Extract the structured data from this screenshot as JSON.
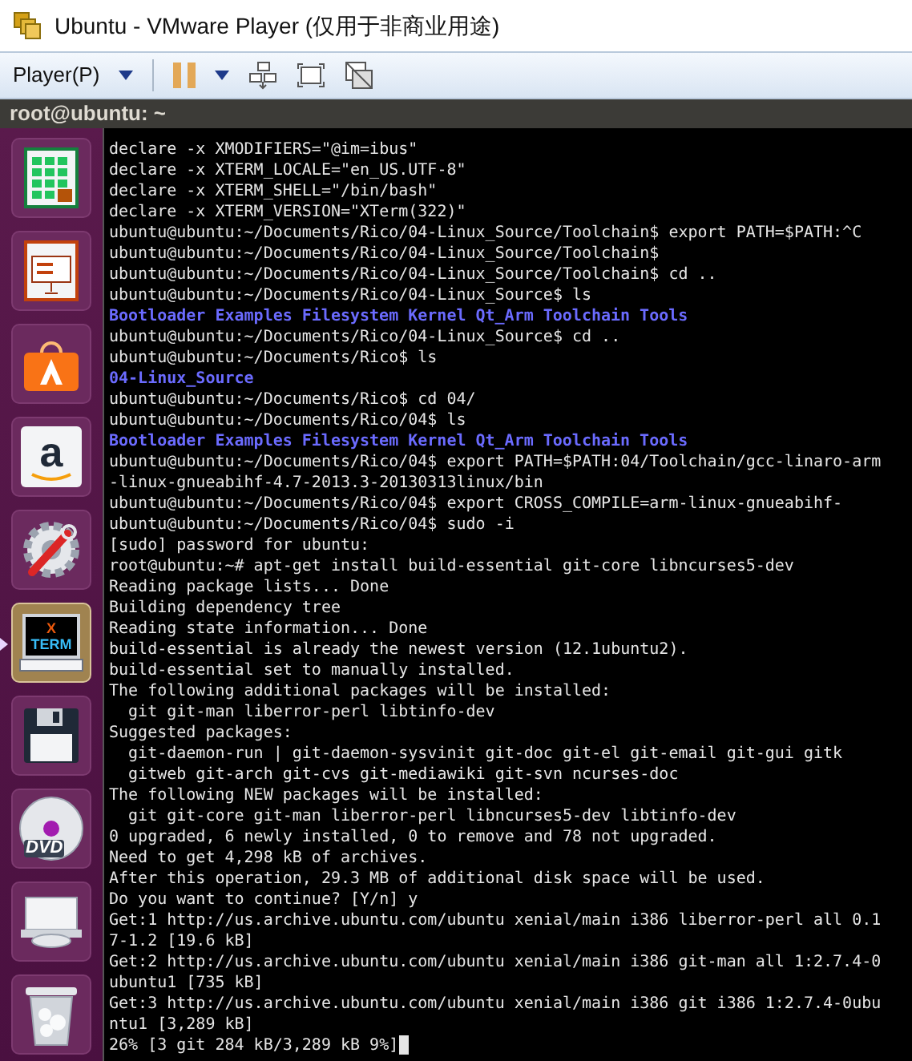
{
  "window": {
    "title": "Ubuntu - VMware Player (仅用于非商业用途)"
  },
  "toolbar": {
    "player_menu": "Player(P)"
  },
  "panel_title": "root@ubuntu: ~",
  "launcher": [
    {
      "kind": "spreadsheet",
      "selected": false
    },
    {
      "kind": "presentation",
      "selected": false
    },
    {
      "kind": "software",
      "selected": false
    },
    {
      "kind": "amazon",
      "icon_text": "a",
      "selected": false
    },
    {
      "kind": "settings",
      "selected": false
    },
    {
      "kind": "xterm",
      "icon_text": [
        "X",
        "TERM"
      ],
      "selected": true
    },
    {
      "kind": "floppy",
      "selected": false
    },
    {
      "kind": "dvd",
      "icon_text": "DVD",
      "selected": false
    },
    {
      "kind": "drive",
      "selected": false
    },
    {
      "kind": "trash",
      "selected": false
    }
  ],
  "terminal": {
    "cursor_visible": true,
    "lines": [
      {
        "kind": "text",
        "text": "declare -x XMODIFIERS=\"@im=ibus\""
      },
      {
        "kind": "text",
        "text": "declare -x XTERM_LOCALE=\"en_US.UTF-8\""
      },
      {
        "kind": "text",
        "text": "declare -x XTERM_SHELL=\"/bin/bash\""
      },
      {
        "kind": "text",
        "text": "declare -x XTERM_VERSION=\"XTerm(322)\""
      },
      {
        "kind": "text",
        "text": "ubuntu@ubuntu:~/Documents/Rico/04-Linux_Source/Toolchain$ export PATH=$PATH:^C"
      },
      {
        "kind": "text",
        "text": "ubuntu@ubuntu:~/Documents/Rico/04-Linux_Source/Toolchain$"
      },
      {
        "kind": "text",
        "text": "ubuntu@ubuntu:~/Documents/Rico/04-Linux_Source/Toolchain$ cd .."
      },
      {
        "kind": "text",
        "text": "ubuntu@ubuntu:~/Documents/Rico/04-Linux_Source$ ls"
      },
      {
        "kind": "dirs",
        "items": [
          "Bootloader",
          "Examples",
          "Filesystem",
          "Kernel",
          "Qt_Arm",
          "Toolchain",
          "Tools"
        ]
      },
      {
        "kind": "text",
        "text": "ubuntu@ubuntu:~/Documents/Rico/04-Linux_Source$ cd .."
      },
      {
        "kind": "text",
        "text": "ubuntu@ubuntu:~/Documents/Rico$ ls"
      },
      {
        "kind": "dirs",
        "items": [
          "04-Linux_Source"
        ]
      },
      {
        "kind": "text",
        "text": "ubuntu@ubuntu:~/Documents/Rico$ cd 04/"
      },
      {
        "kind": "text",
        "text": "ubuntu@ubuntu:~/Documents/Rico/04$ ls"
      },
      {
        "kind": "dirs",
        "items": [
          "Bootloader",
          "Examples",
          "Filesystem",
          "Kernel",
          "Qt_Arm",
          "Toolchain",
          "Tools"
        ]
      },
      {
        "kind": "text",
        "text": "ubuntu@ubuntu:~/Documents/Rico/04$ export PATH=$PATH:04/Toolchain/gcc-linaro-arm"
      },
      {
        "kind": "text",
        "text": "-linux-gnueabihf-4.7-2013.3-20130313linux/bin"
      },
      {
        "kind": "text",
        "text": "ubuntu@ubuntu:~/Documents/Rico/04$ export CROSS_COMPILE=arm-linux-gnueabihf-"
      },
      {
        "kind": "text",
        "text": "ubuntu@ubuntu:~/Documents/Rico/04$ sudo -i"
      },
      {
        "kind": "text",
        "text": "[sudo] password for ubuntu:"
      },
      {
        "kind": "text",
        "text": "root@ubuntu:~# apt-get install build-essential git-core libncurses5-dev"
      },
      {
        "kind": "text",
        "text": "Reading package lists... Done"
      },
      {
        "kind": "text",
        "text": "Building dependency tree"
      },
      {
        "kind": "text",
        "text": "Reading state information... Done"
      },
      {
        "kind": "text",
        "text": "build-essential is already the newest version (12.1ubuntu2)."
      },
      {
        "kind": "text",
        "text": "build-essential set to manually installed."
      },
      {
        "kind": "text",
        "text": "The following additional packages will be installed:"
      },
      {
        "kind": "text",
        "text": "  git git-man liberror-perl libtinfo-dev"
      },
      {
        "kind": "text",
        "text": "Suggested packages:"
      },
      {
        "kind": "text",
        "text": "  git-daemon-run | git-daemon-sysvinit git-doc git-el git-email git-gui gitk"
      },
      {
        "kind": "text",
        "text": "  gitweb git-arch git-cvs git-mediawiki git-svn ncurses-doc"
      },
      {
        "kind": "text",
        "text": "The following NEW packages will be installed:"
      },
      {
        "kind": "text",
        "text": "  git git-core git-man liberror-perl libncurses5-dev libtinfo-dev"
      },
      {
        "kind": "text",
        "text": "0 upgraded, 6 newly installed, 0 to remove and 78 not upgraded."
      },
      {
        "kind": "text",
        "text": "Need to get 4,298 kB of archives."
      },
      {
        "kind": "text",
        "text": "After this operation, 29.3 MB of additional disk space will be used."
      },
      {
        "kind": "text",
        "text": "Do you want to continue? [Y/n] y"
      },
      {
        "kind": "text",
        "text": "Get:1 http://us.archive.ubuntu.com/ubuntu xenial/main i386 liberror-perl all 0.1"
      },
      {
        "kind": "text",
        "text": "7-1.2 [19.6 kB]"
      },
      {
        "kind": "text",
        "text": "Get:2 http://us.archive.ubuntu.com/ubuntu xenial/main i386 git-man all 1:2.7.4-0"
      },
      {
        "kind": "text",
        "text": "ubuntu1 [735 kB]"
      },
      {
        "kind": "text",
        "text": "Get:3 http://us.archive.ubuntu.com/ubuntu xenial/main i386 git i386 1:2.7.4-0ubu"
      },
      {
        "kind": "text",
        "text": "ntu1 [3,289 kB]"
      },
      {
        "kind": "text",
        "text": "26% [3 git 284 kB/3,289 kB 9%]"
      }
    ]
  }
}
